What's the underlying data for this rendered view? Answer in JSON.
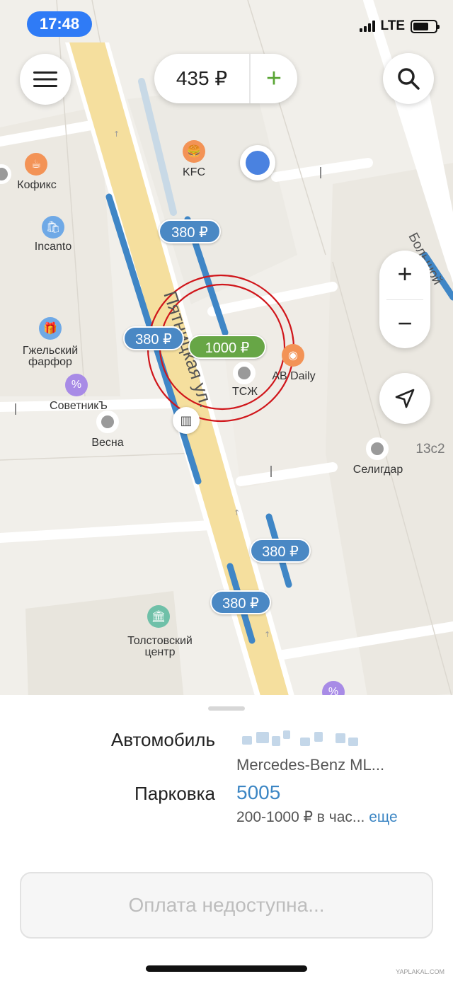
{
  "status_bar": {
    "time": "17:48",
    "network": "LTE"
  },
  "header": {
    "balance": "435 ₽",
    "add_symbol": "+"
  },
  "map": {
    "price_tags": [
      {
        "id": "p1",
        "label": "380 ₽",
        "color": "blue"
      },
      {
        "id": "p2",
        "label": "380 ₽",
        "color": "blue"
      },
      {
        "id": "p3",
        "label": "1000 ₽",
        "color": "green"
      },
      {
        "id": "p4",
        "label": "380 ₽",
        "color": "blue"
      },
      {
        "id": "p5",
        "label": "380 ₽",
        "color": "blue"
      }
    ],
    "street_labels": [
      "Пятницкая ул.",
      "Большой"
    ],
    "pois": {
      "kfc": "KFC",
      "kofiks": "Кофикс",
      "incanto": "Incanto",
      "gzhel_1": "Гжельский",
      "gzhel_2": "фарфор",
      "sovetnik": "СоветникЪ",
      "vesna": "Весна",
      "ab_daily": "AB Daily",
      "tszh": "ТСЖ",
      "seligdar": "Селигдар",
      "house_13c2": "13с2",
      "tolstoy_1": "Толстовский",
      "tolstoy_2": "центр"
    },
    "zoom_in": "+",
    "zoom_out": "−"
  },
  "sheet": {
    "car_label": "Автомобиль",
    "car_model": "Mercedes-Benz ML...",
    "parking_label": "Парковка",
    "parking_number": "5005",
    "rate_text": "200-1000 ₽ в час...",
    "rate_more": "еще",
    "pay_button": "Оплата недоступна..."
  },
  "watermark": "YAPLAKAL.COM",
  "colors": {
    "accent_blue": "#2f7bf6",
    "price_blue": "#4a88c4",
    "price_green": "#67a646",
    "annotation_red": "#d0161b"
  },
  "icons": [
    "menu-icon",
    "search-icon",
    "navigation-arrow-icon",
    "location-dot-icon",
    "parking-meter-icon"
  ]
}
